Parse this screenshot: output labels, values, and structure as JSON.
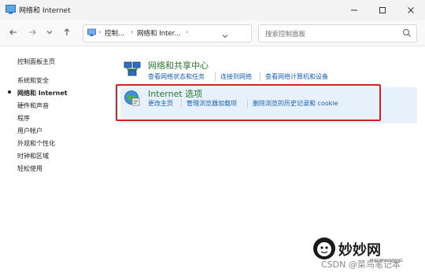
{
  "window": {
    "title": "网络和 Internet",
    "controls": [
      "minimize-icon",
      "maximize-icon",
      "close-icon"
    ]
  },
  "nav": {
    "back_icon": "arrow-left-icon",
    "forward_icon": "arrow-right-icon",
    "recent_icon": "chevron-down-icon",
    "up_icon": "arrow-up-icon",
    "breadcrumb": [
      "控制...",
      "网络和 Inter..."
    ],
    "refresh_icon": "refresh-icon"
  },
  "search": {
    "placeholder": "搜索控制面板"
  },
  "sidebar": {
    "items": [
      {
        "label": "控制面板主页"
      },
      {
        "label": "系统和安全"
      },
      {
        "label": "网络和 Internet",
        "active": true
      },
      {
        "label": "硬件和声音"
      },
      {
        "label": "程序"
      },
      {
        "label": "用户帐户"
      },
      {
        "label": "外观和个性化"
      },
      {
        "label": "时钟和区域"
      },
      {
        "label": "轻松使用"
      }
    ]
  },
  "categories": [
    {
      "title": "网络和共享中心",
      "icon": "network-sharing-icon",
      "links": [
        "查看网络状态和任务",
        "连接到网络",
        "查看网络计算机和设备"
      ]
    },
    {
      "title": "Internet 选项",
      "icon": "internet-options-icon",
      "links": [
        "更改主页",
        "管理浏览器加载项",
        "删除浏览的历史记录和 cookie"
      ]
    }
  ],
  "watermark": {
    "brand": "妙妙网",
    "brand_sub": "MIAOMIAOWANG",
    "csdn": "CSDN @菜鸟笔记本"
  },
  "colors": {
    "link": "#1a5fb4",
    "category_title": "#2a7a2a",
    "highlight": "#e6f1fb",
    "annotation_box": "#d61f1f"
  }
}
